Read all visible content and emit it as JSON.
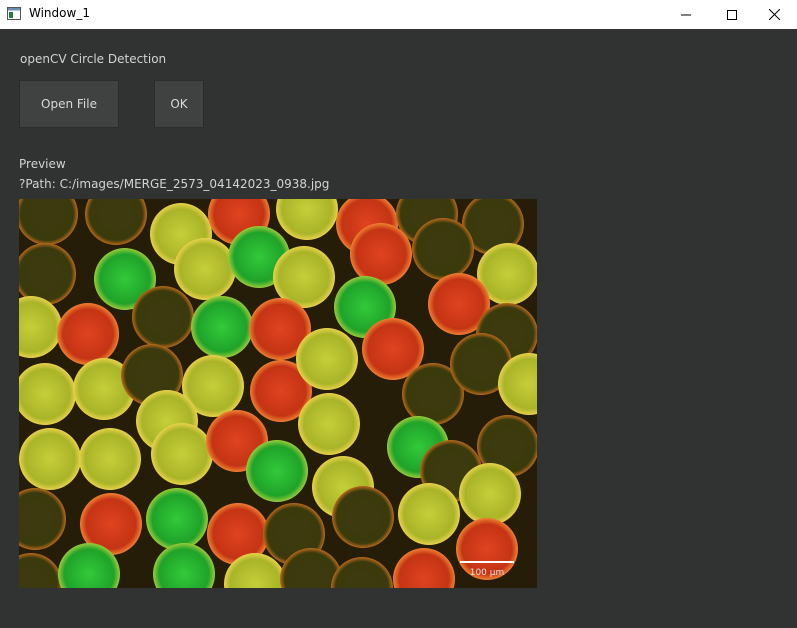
{
  "window": {
    "title": "Window_1",
    "icon": "app-window-icon",
    "controls": [
      "minimize-icon",
      "maximize-icon",
      "close-icon"
    ]
  },
  "app": {
    "heading": "openCV Circle Detection"
  },
  "buttons": {
    "open_file": "Open File",
    "ok": "OK"
  },
  "preview": {
    "label": "Preview",
    "path": "?Path: C:/images/MERGE_2573_04142023_0938.jpg"
  },
  "image": {
    "scale_bar_text": "100 µm"
  },
  "colors": {
    "background": "#303332",
    "titlebar": "#ffffff",
    "button": "#3f4241",
    "text": "#d3d3d3"
  }
}
